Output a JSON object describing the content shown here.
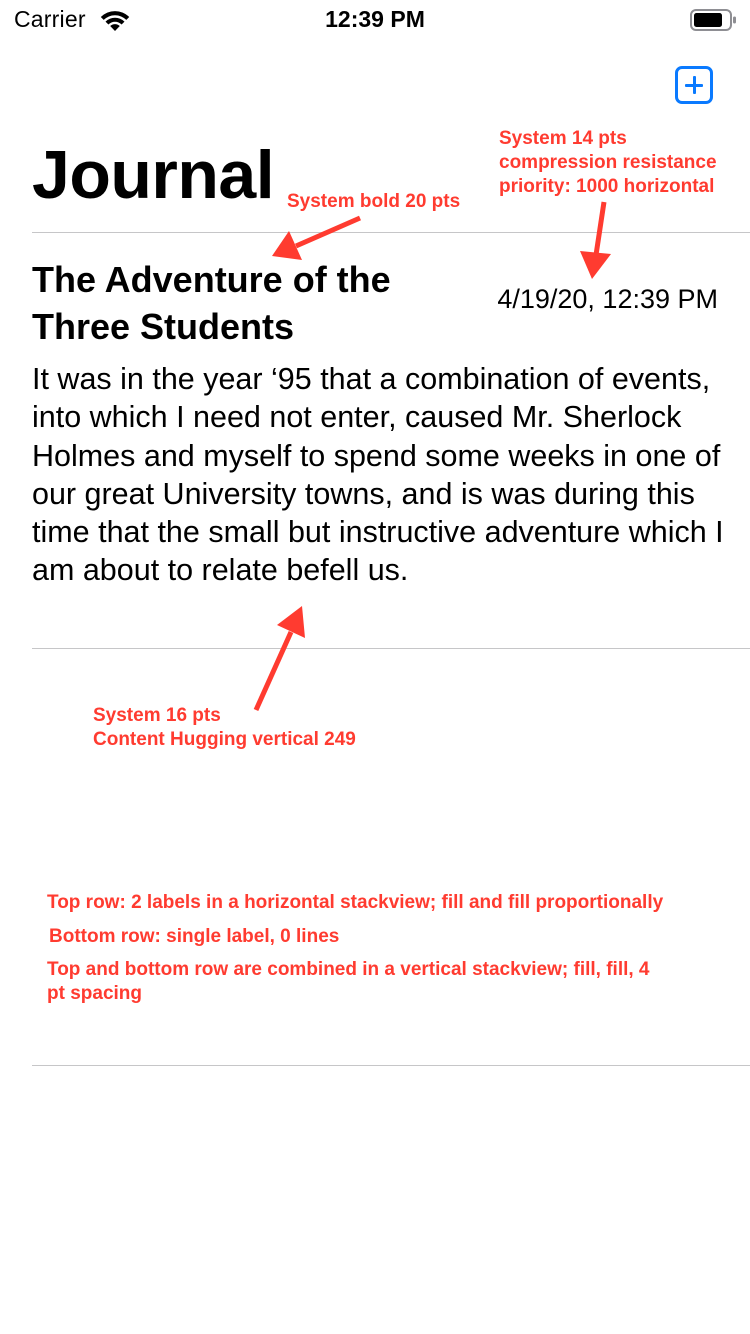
{
  "status_bar": {
    "carrier": "Carrier",
    "time": "12:39 PM",
    "icons": [
      "wifi-icon",
      "battery-icon"
    ]
  },
  "nav": {
    "add_icon": "plus-square-icon",
    "title": "Journal",
    "accent_color": "#0a7aff"
  },
  "entry": {
    "title": "The Adventure of the Three Students",
    "date": "4/19/20, 12:39 PM",
    "body": "It was in the year ‘95 that a combination of events, into which I need not enter, caused Mr. Sherlock Holmes and myself to spend some weeks in one of our great University towns, and is was during this time that the small but instructive adventure which I am about to relate befell us."
  },
  "annotations": {
    "color": "#ff3b30",
    "title_font": "System bold 20 pts",
    "date_font": [
      "System 14 pts",
      "compression resistance",
      "priority: 1000 horizontal"
    ],
    "body_font": [
      "System 16 pts",
      "Content Hugging vertical 249"
    ],
    "notes": [
      [
        "Top row: 2 labels in a horizontal stackview; fill and fill proportionally"
      ],
      [
        "Bottom row: single label, 0 lines"
      ],
      [
        "Top and bottom row are combined in a vertical stackview; fill, fill, 4",
        "pt spacing"
      ]
    ]
  }
}
